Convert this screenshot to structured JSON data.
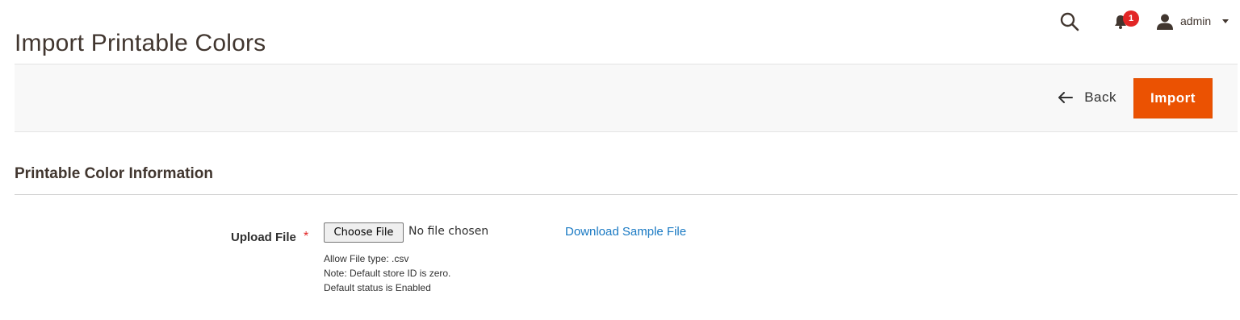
{
  "header": {
    "title": "Import Printable Colors",
    "notifications_count": "1",
    "user_name": "admin",
    "icons": {
      "search": "search-icon",
      "notifications": "bell-icon",
      "user": "user-icon",
      "menu": "caret-down-icon"
    }
  },
  "actions": {
    "back_label": "Back",
    "import_label": "Import"
  },
  "section": {
    "title": "Printable Color Information"
  },
  "form": {
    "upload_label": "Upload File",
    "required_marker": "*",
    "choose_file_label": "Choose File",
    "file_status": "No file chosen",
    "download_link": "Download Sample File",
    "notes": [
      "Allow File type: .csv",
      "Note: Default store ID is zero.",
      "Default status is Enabled"
    ]
  },
  "colors": {
    "accent": "#eb5202",
    "badge": "#e22626",
    "link": "#1979c3",
    "toolbar_bg": "#f8f8f8"
  }
}
